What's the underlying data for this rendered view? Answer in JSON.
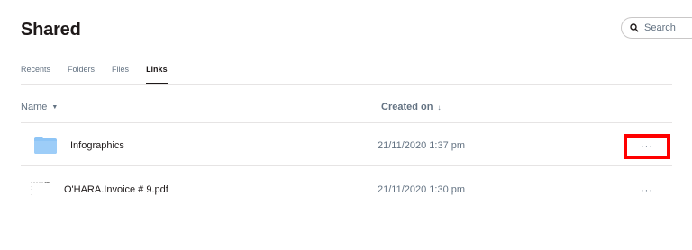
{
  "header": {
    "title": "Shared",
    "search_placeholder": "Search"
  },
  "tabs": [
    {
      "label": "Recents",
      "active": false
    },
    {
      "label": "Folders",
      "active": false
    },
    {
      "label": "Files",
      "active": false
    },
    {
      "label": "Links",
      "active": true
    }
  ],
  "table": {
    "columns": {
      "name": "Name",
      "created_on": "Created on"
    },
    "rows": [
      {
        "name": "Infographics",
        "created_on": "21/11/2020 1:37 pm",
        "type": "folder-icon",
        "more": "···"
      },
      {
        "name": "O'HARA.Invoice # 9.pdf",
        "created_on": "21/11/2020 1:30 pm",
        "type": "pdf-thumbnail-icon",
        "more": "···"
      }
    ]
  },
  "colors": {
    "folder": "#8ec5f6",
    "highlight": "#ff0000",
    "muted_text": "#637282"
  }
}
